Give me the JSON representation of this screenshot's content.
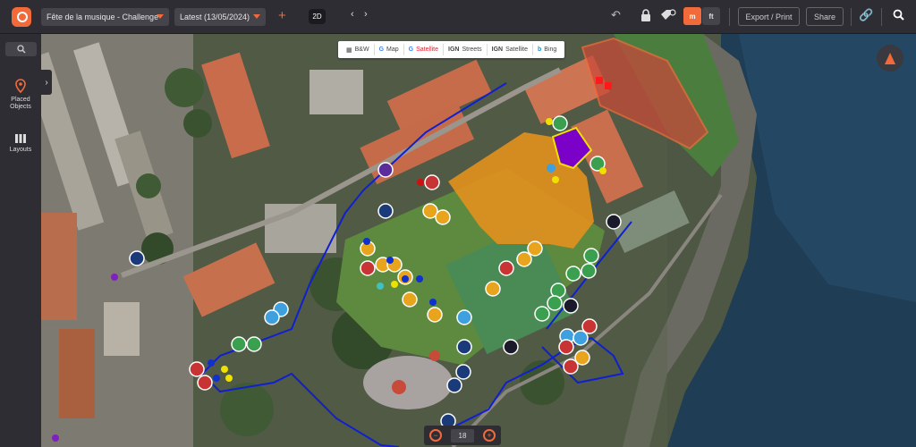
{
  "header": {
    "event_select": "Fête de la musique - Challenge",
    "version_select": "Latest (13/05/2024)",
    "mode_label": "2D",
    "unit_m": "m",
    "unit_ft": "ft",
    "export_label": "Export / Print",
    "share_label": "Share"
  },
  "sidebar": {
    "placed_objects_label": "Placed Objects",
    "layouts_label": "Layouts"
  },
  "map": {
    "layers": [
      "B&W",
      "Map",
      "Satellite",
      "Streets",
      "Satellite",
      "Bing"
    ],
    "selected_layer_index": 2,
    "zoom_level": "18"
  },
  "colors": {
    "accent": "#f26a3a",
    "orange_zone": "#e0901e",
    "red_zone": "#c84a3a",
    "purple_zone": "#7b00c8",
    "route": "#1020d0"
  }
}
